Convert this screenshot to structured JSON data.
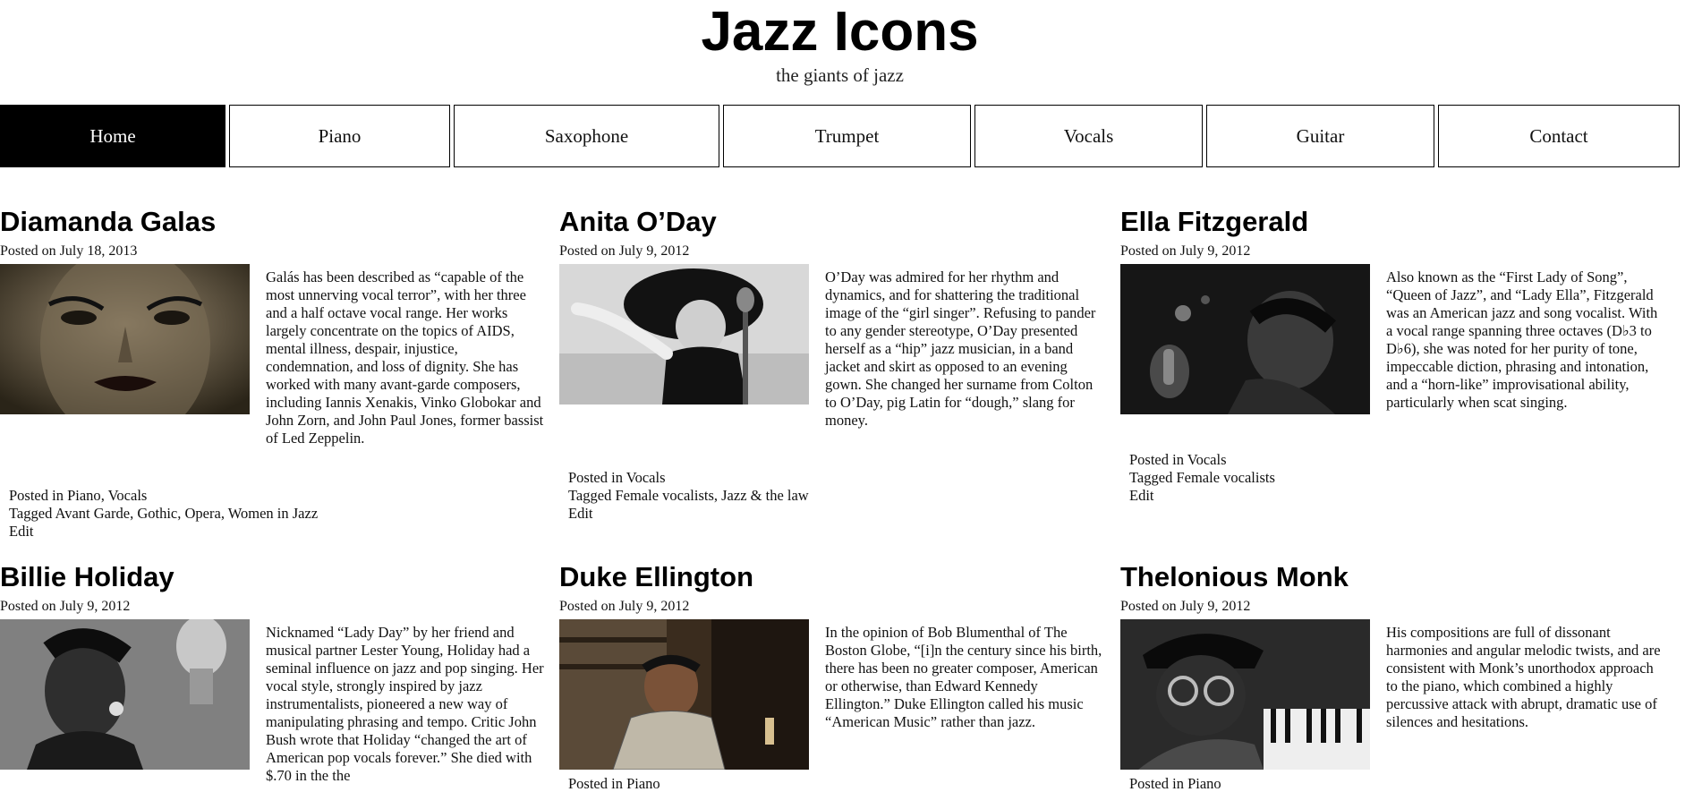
{
  "site": {
    "title": "Jazz Icons",
    "description": "the giants of jazz"
  },
  "nav": [
    "Home",
    "Piano",
    "Saxophone",
    "Trumpet",
    "Vocals",
    "Guitar",
    "Contact"
  ],
  "posts": [
    {
      "title": "Diamanda Galas",
      "date": "July 18, 2013",
      "excerpt": "Galás has been described as “capable of the most unnerving vocal terror”, with her three and a half octave vocal range. Her works largely concentrate on the topics of AIDS, mental illness, despair, injustice, condemnation, and loss of dignity. She has worked with many avant-garde composers, including Iannis Xenakis, Vinko Globokar and John Zorn, and John Paul Jones, former bassist of Led Zeppelin.",
      "categories": [
        "Piano",
        "Vocals"
      ],
      "tags": [
        "Avant Garde",
        "Gothic",
        "Opera",
        "Women in Jazz"
      ]
    },
    {
      "title": "Anita O’Day",
      "date": "July 9, 2012",
      "excerpt": "O’Day was admired for her rhythm and dynamics, and for shattering the traditional image of the “girl singer”. Refusing to pander to any gender stereotype, O’Day presented herself as a “hip” jazz musician, in a band jacket and skirt as opposed to an evening gown. She changed her surname from Colton to O’Day, pig Latin for “dough,” slang for money.",
      "categories": [
        "Vocals"
      ],
      "tags": [
        "Female vocalists",
        "Jazz & the law"
      ]
    },
    {
      "title": "Ella Fitzgerald",
      "date": "July 9, 2012",
      "excerpt": "Also known as the “First Lady of Song”, “Queen of Jazz”, and “Lady Ella”, Fitzgerald was an American jazz and song vocalist. With a vocal range spanning three octaves (D♭3 to D♭6), she was noted for her purity of tone, impeccable diction, phrasing and intonation, and a “horn-like” improvisational ability, particularly when scat singing.",
      "categories": [
        "Vocals"
      ],
      "tags": [
        "Female vocalists"
      ]
    },
    {
      "title": "Billie Holiday",
      "date": "July 9, 2012",
      "excerpt": "Nicknamed “Lady Day” by her friend and musical partner Lester Young, Holiday had a seminal influence on jazz and pop singing. Her vocal style, strongly inspired by jazz instrumentalists, pioneered a new way of manipulating phrasing and tempo. Critic John Bush wrote that Holiday “changed the art of American pop vocals forever.” She died with $.70 in the the"
    },
    {
      "title": "Duke Ellington",
      "date": "July 9, 2012",
      "excerpt": "In the opinion of Bob Blumenthal of The Boston Globe, “[i]n the century since his birth, there has been no greater composer, American or otherwise, than Edward Kennedy Ellington.” Duke Ellington called his music “American Music” rather than jazz.",
      "categories": [
        "Piano"
      ]
    },
    {
      "title": "Thelonious Monk",
      "date": "July 9, 2012",
      "excerpt": "His compositions are full of dissonant harmonies and angular melodic twists, and are consistent with Monk’s unorthodox approach to the piano, which combined a highly percussive attack with abrupt, dramatic use of silences and hesitations.",
      "categories": [
        "Piano"
      ]
    }
  ],
  "labels": {
    "posted_on": "Posted on",
    "posted_in": "Posted in",
    "tagged": "Tagged",
    "edit": "Edit",
    "sep": ", "
  }
}
